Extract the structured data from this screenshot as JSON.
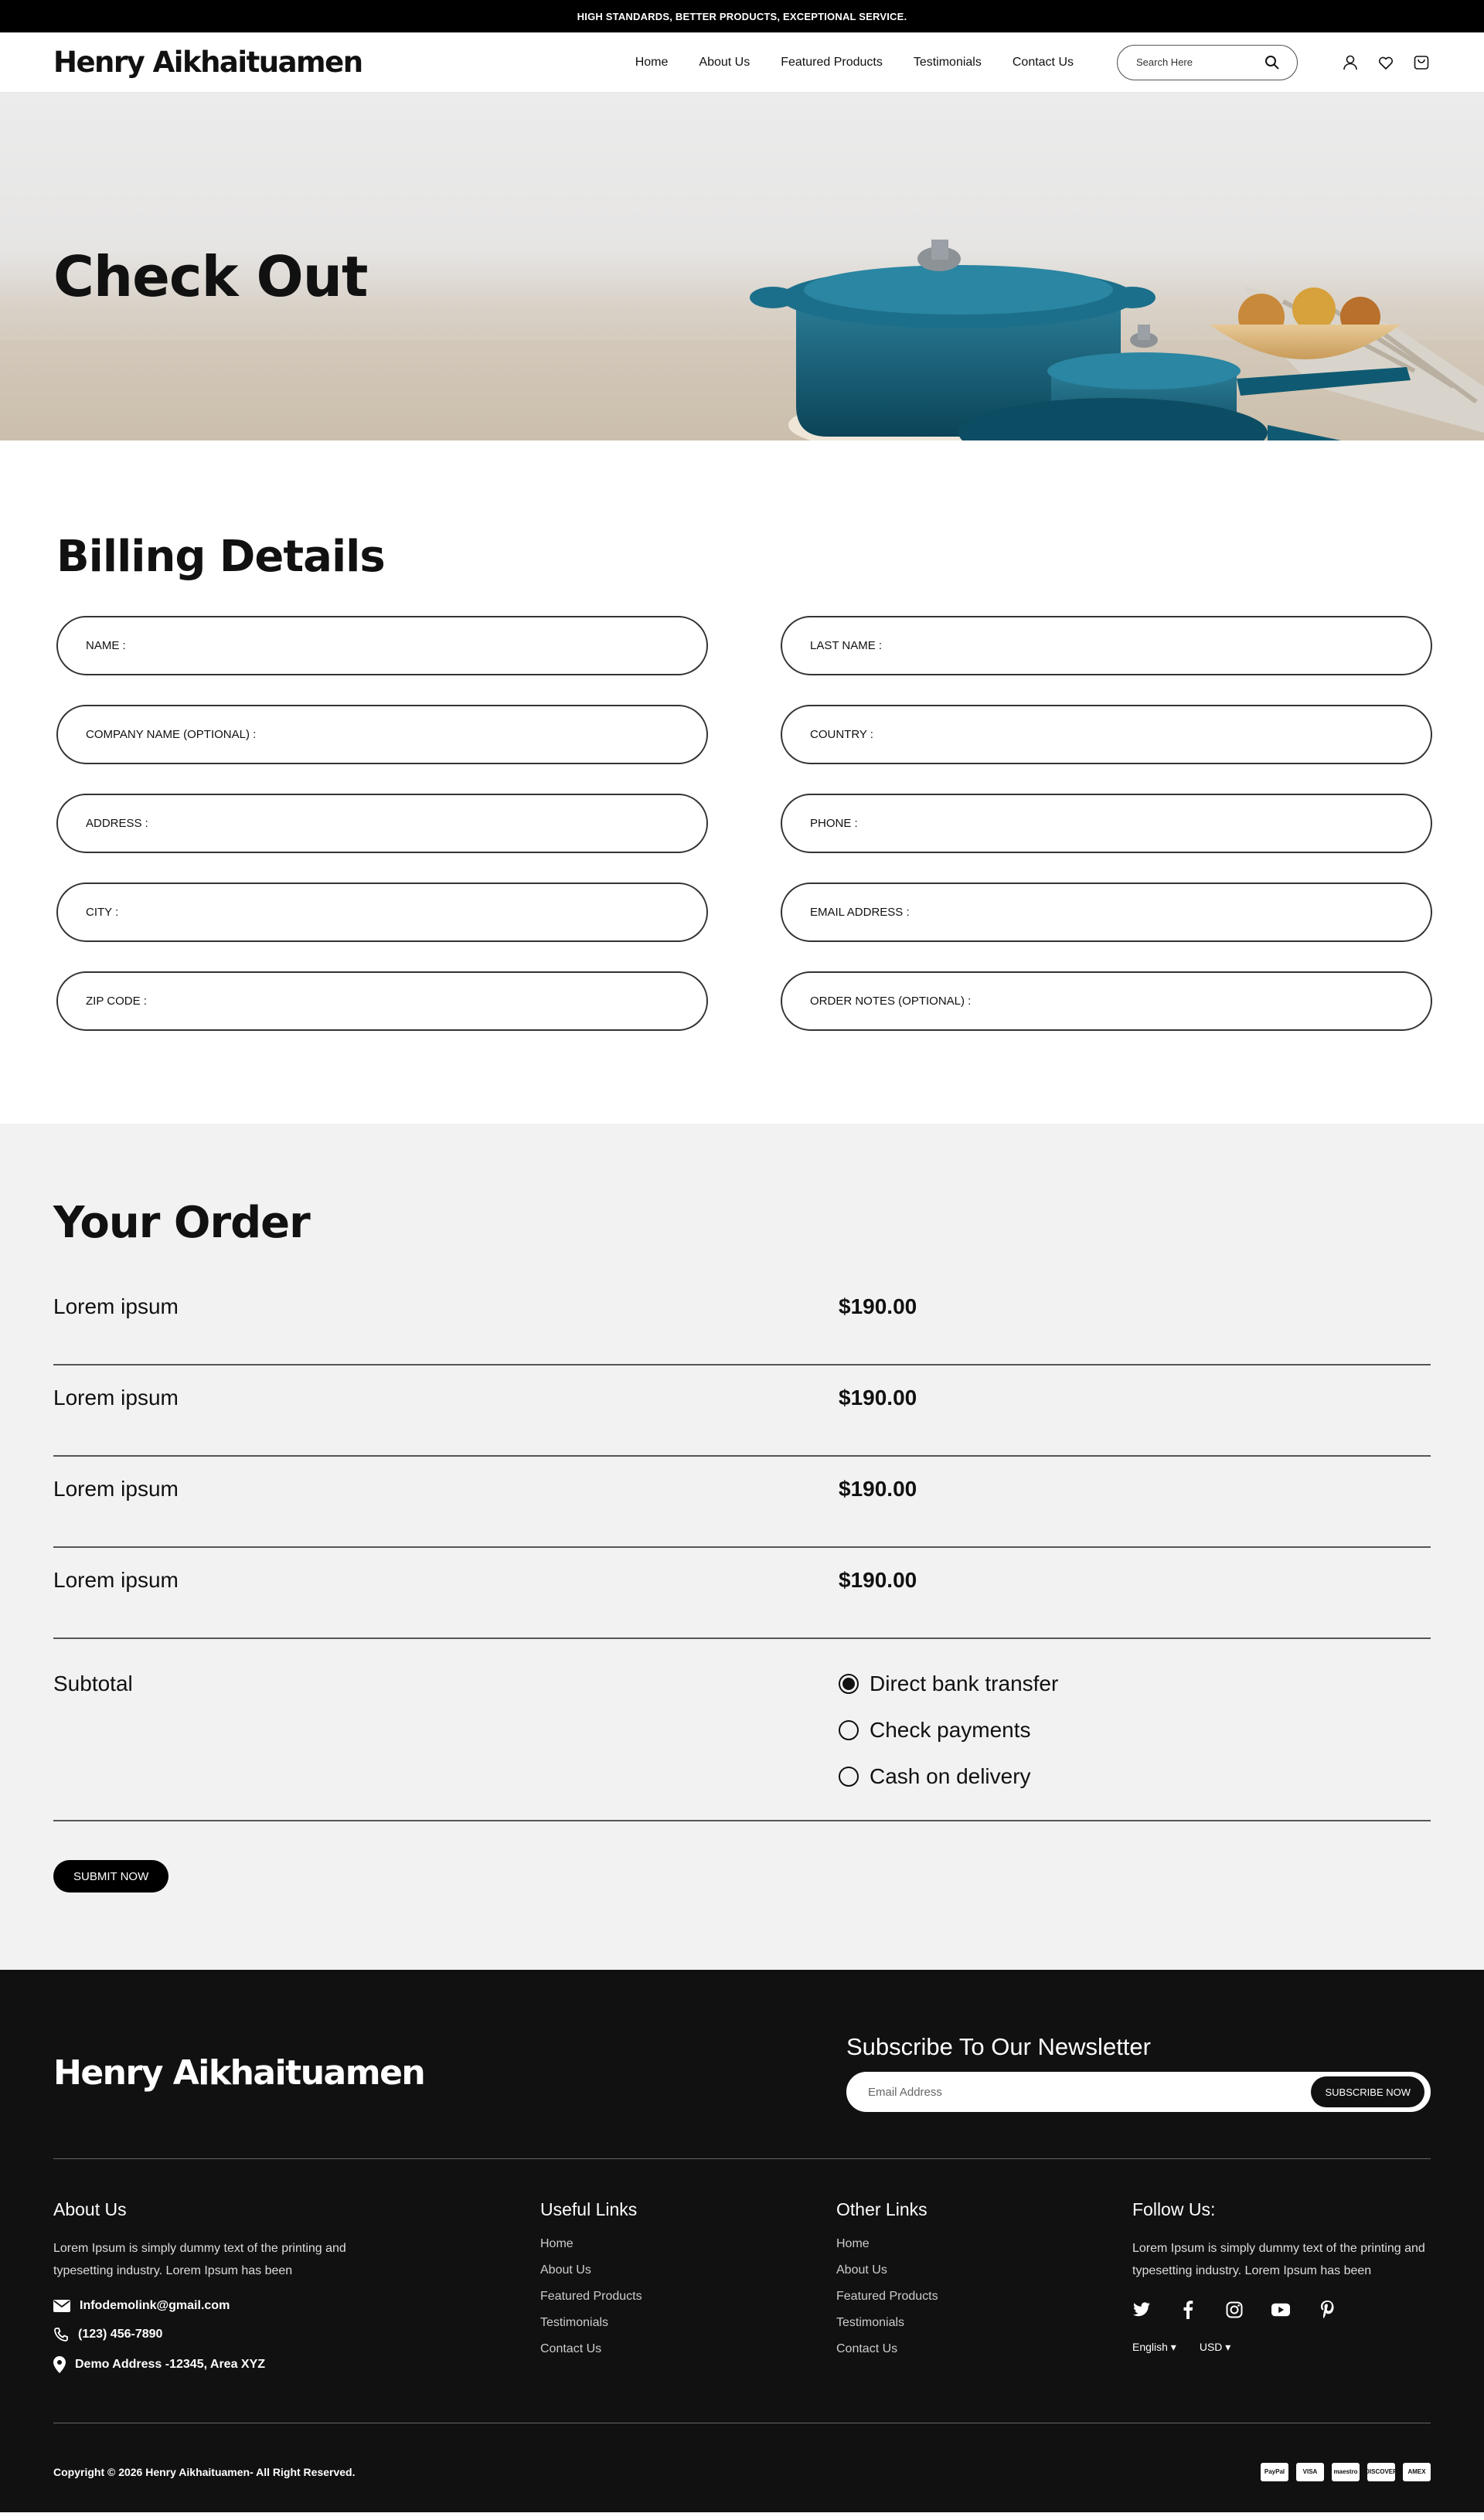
{
  "topbar": {
    "text": "HIGH STANDARDS, BETTER PRODUCTS, EXCEPTIONAL SERVICE."
  },
  "header": {
    "logo": "Henry Aikhaituamen",
    "nav": [
      "Home",
      "About Us",
      "Featured Products",
      "Testimonials",
      "Contact Us"
    ],
    "search_placeholder": "Search Here"
  },
  "hero": {
    "title": "Check Out"
  },
  "billing": {
    "title": "Billing Details",
    "fields": [
      "NAME :",
      "LAST NAME :",
      "COMPANY NAME (OPTIONAL) :",
      "COUNTRY :",
      "ADDRESS :",
      "PHONE :",
      "CITY :",
      "EMAIL ADDRESS :",
      "ZIP CODE :",
      "ORDER NOTES (OPTIONAL) :"
    ]
  },
  "order": {
    "title": "Your Order",
    "items": [
      {
        "name": "Lorem ipsum",
        "price": "$190.00"
      },
      {
        "name": "Lorem ipsum",
        "price": "$190.00"
      },
      {
        "name": "Lorem ipsum",
        "price": "$190.00"
      },
      {
        "name": "Lorem ipsum",
        "price": "$190.00"
      }
    ],
    "subtotal_label": "Subtotal",
    "payment_options": [
      "Direct bank transfer",
      "Check payments",
      "Cash on delivery"
    ],
    "selected_payment": "Direct bank transfer",
    "submit_label": "SUBMIT NOW"
  },
  "footer": {
    "logo": "Henry Aikhaituamen",
    "newsletter_title": "Subscribe To Our Newsletter",
    "newsletter_placeholder": "Email Address",
    "subscribe_label": "SUBSCRIBE NOW",
    "about_title": "About Us",
    "about_text": "Lorem Ipsum is simply dummy text of the printing and typesetting industry. Lorem Ipsum has been",
    "email": "Infodemolink@gmail.com",
    "phone": "(123) 456-7890",
    "address": "Demo Address -12345, Area XYZ",
    "useful_title": "Useful Links",
    "useful_links": [
      "Home",
      "About Us",
      "Featured Products",
      "Testimonials",
      "Contact Us"
    ],
    "other_title": "Other Links",
    "other_links": [
      "Home",
      "About Us",
      "Featured Products",
      "Testimonials",
      "Contact Us"
    ],
    "follow_title": "Follow Us:",
    "follow_text": "Lorem Ipsum is simply dummy text of the printing and typesetting industry. Lorem Ipsum has been",
    "language": "English",
    "currency": "USD",
    "copyright": "Copyright © 2026 Henry Aikhaituamen- All Right Reserved.",
    "payments": [
      "PayPal",
      "VISA",
      "maestro",
      "DISCOVER",
      "AMEX"
    ]
  }
}
